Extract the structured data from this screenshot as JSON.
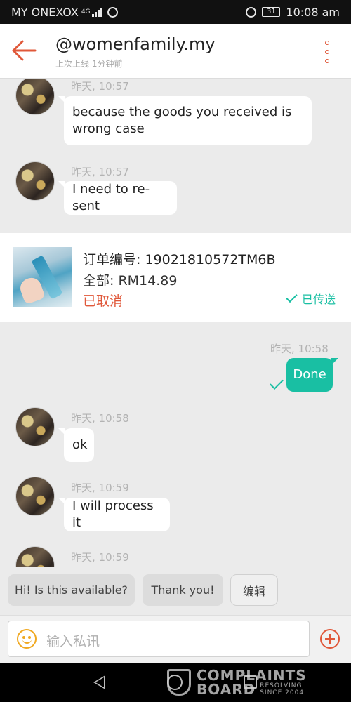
{
  "status_bar": {
    "carrier": "MY ONEXOX",
    "network": "4G",
    "battery": "31",
    "time": "10:08 am"
  },
  "header": {
    "title": "@womenfamily.my",
    "subtitle": "上次上线 1分钟前"
  },
  "messages": [
    {
      "time": "昨天, 10:57",
      "text_line1": "because the goods you received is",
      "text_line2": "wrong case",
      "direction": "in"
    },
    {
      "time": "昨天, 10:57",
      "text": "I need to re-sent",
      "direction": "in"
    },
    {
      "time": "昨天, 10:58",
      "text": "Done",
      "direction": "out"
    },
    {
      "time": "昨天, 10:58",
      "text": "ok",
      "direction": "in"
    },
    {
      "time": "昨天, 10:59",
      "text": "I will process it",
      "direction": "in"
    },
    {
      "time": "昨天, 10:59",
      "direction": "in"
    }
  ],
  "order": {
    "number": "订单编号: 19021810572TM6B",
    "total": "全部: RM14.89",
    "status": "已取消",
    "sent_label": "已传送"
  },
  "quick_replies": [
    "Hi! Is this available?",
    "Thank you!",
    "编辑"
  ],
  "input": {
    "placeholder": "输入私讯"
  },
  "watermark": {
    "line1": "COMPLAINTS",
    "line2": "BOARD",
    "tag1": "RESOLVING",
    "tag2": "SINCE 2004"
  },
  "colors": {
    "accent": "#e0583a",
    "teal": "#19bfa3",
    "chat_bg": "#ebebeb"
  }
}
